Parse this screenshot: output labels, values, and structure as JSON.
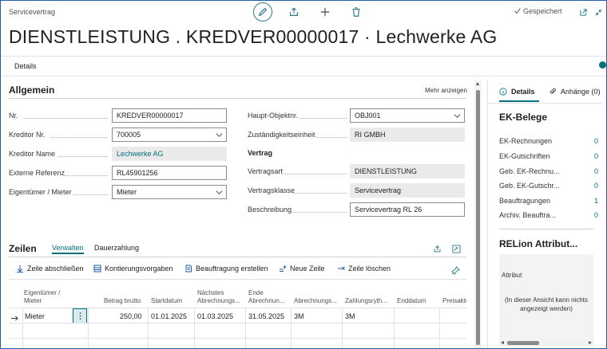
{
  "header": {
    "breadcrumb": "Servicevertrag",
    "saved_label": "Gespeichert",
    "title": "DIENSTLEISTUNG . KREDVER00000017 · Lechwerke AG",
    "details_tab": "Details"
  },
  "general": {
    "title": "Allgemein",
    "show_more": "Mehr anzeigen",
    "left": [
      {
        "label": "Nr.",
        "value": "KREDVER00000017",
        "type": "edit"
      },
      {
        "label": "Kreditor Nr.",
        "value": "700005",
        "type": "select"
      },
      {
        "label": "Kreditor Name",
        "value": "Lechwerke AG",
        "type": "ro-link"
      },
      {
        "label": "Externe Referenz",
        "value": "RL45901256",
        "type": "edit"
      },
      {
        "label": "Eigentümer / Mieter",
        "value": "Mieter",
        "type": "select"
      }
    ],
    "right_top": [
      {
        "label": "Haupt-Objektnr.",
        "value": "OBJ001",
        "type": "select"
      },
      {
        "label": "Zuständigkeitseinheit",
        "value": "RI GMBH",
        "type": "ro"
      }
    ],
    "contract_group": "Vertrag",
    "right_bottom": [
      {
        "label": "Vertragsart",
        "value": "DIENSTLEISTUNG",
        "type": "ro"
      },
      {
        "label": "Vertragsklasse",
        "value": "Servicevertrag",
        "type": "ro"
      },
      {
        "label": "Beschreibung",
        "value": "Servicevertrag RL 26",
        "type": "edit"
      }
    ]
  },
  "lines": {
    "title": "Zeilen",
    "tabs": [
      "Verwalten",
      "Dauerzahlung"
    ],
    "actions": [
      "Zeile abschließen",
      "Kontierungsvorgaben",
      "Beauftragung erstellen",
      "Neue Zeile",
      "Zeile löschen"
    ],
    "columns": [
      "Eigentümer / Mieter",
      "Betrag brutto",
      "Startdatum",
      "Nächstes Abrechnungs...",
      "Ende Abrechnun...",
      "Abrechnungs...",
      "Zahlungsryth...",
      "Enddatum",
      "Preisaktu"
    ],
    "rows": [
      {
        "owner": "Mieter",
        "amount": "250,00",
        "start": "01.01.2025",
        "next": "01.03.2025",
        "end": "31.05.2025",
        "billing": "3M",
        "payment": "3M",
        "enddate": "",
        "price": ""
      }
    ]
  },
  "sidebar": {
    "tabs": [
      "Details",
      "Anhänge (0)"
    ],
    "ek_title": "EK-Belege",
    "ek_rows": [
      {
        "label": "EK-Rechnungen",
        "value": "0"
      },
      {
        "label": "EK-Gutschriften",
        "value": "0"
      },
      {
        "label": "Geb. EK-Rechnu...",
        "value": "0"
      },
      {
        "label": "Geb. EK-Gutschr...",
        "value": "0"
      },
      {
        "label": "Beauftragungen",
        "value": "1"
      },
      {
        "label": "Archiv. Beauftra...",
        "value": "0"
      }
    ],
    "relion_title": "RELion Attribut...",
    "attr_label": "Attribut",
    "attr_empty": "(In dieser Ansicht kann nichts angezeigt werden)"
  },
  "colors": {
    "accent": "#00707a",
    "readonly_bg": "#eaeaea",
    "frame": "#1f5ea8"
  }
}
